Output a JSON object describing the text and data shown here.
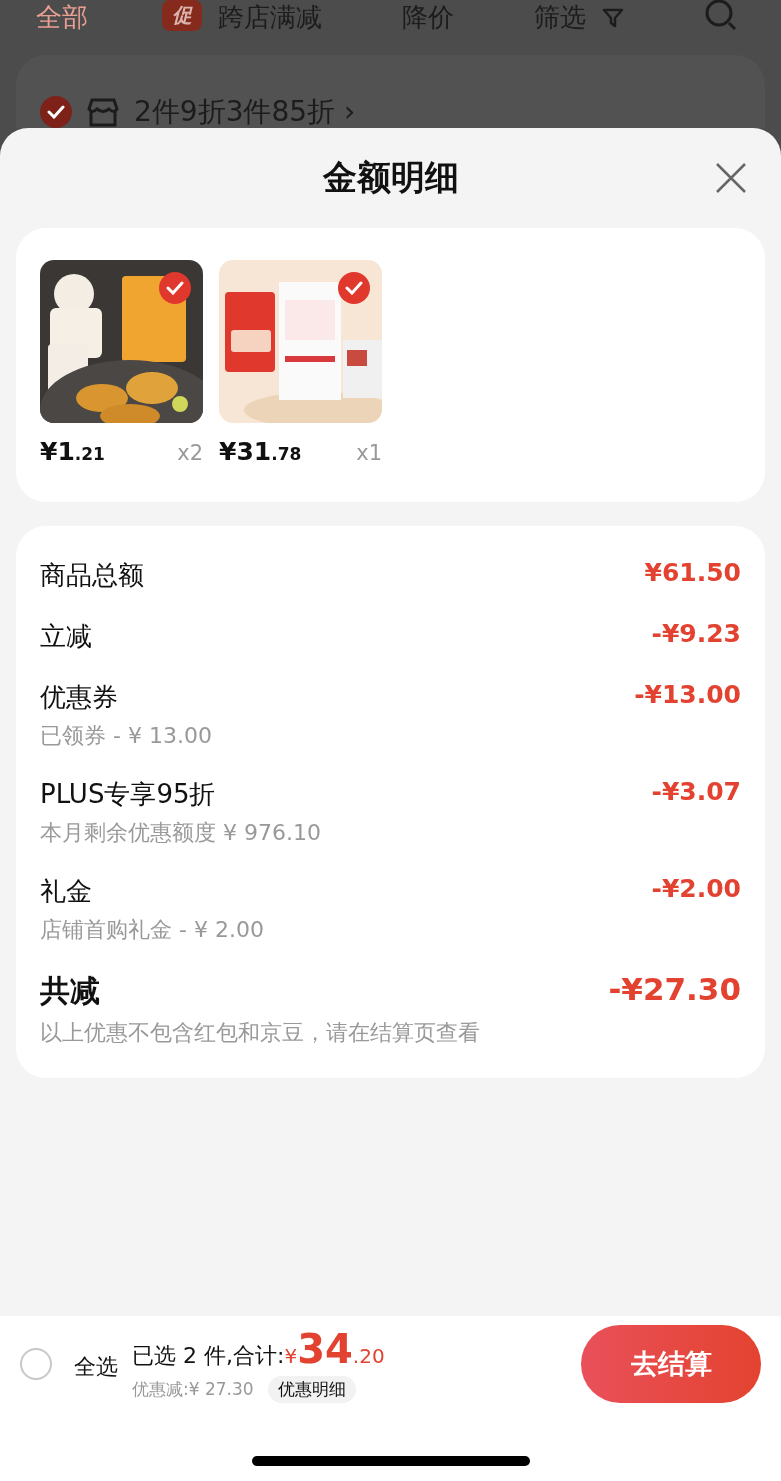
{
  "top_bar": {
    "tabs": [
      {
        "label": "全部",
        "selected": true
      },
      {
        "label": "跨店满减",
        "selected": false,
        "badge": "促"
      },
      {
        "label": "降价",
        "selected": false
      },
      {
        "label": "筛选",
        "selected": false
      }
    ]
  },
  "store_row": {
    "checked": true,
    "text": "2件9折3件85折 ›"
  },
  "sheet": {
    "title": "金额明细",
    "products": [
      {
        "kind": "food",
        "price": "¥1",
        "decimals": ".21",
        "quantity": "x2",
        "checked": true
      },
      {
        "kind": "milk",
        "price": "¥31",
        "decimals": ".78",
        "quantity": "x1",
        "checked": true
      }
    ],
    "breakdown": [
      {
        "kind": "line",
        "label": "商品总额",
        "amount": "¥61.50"
      },
      {
        "kind": "line",
        "label": "立减",
        "amount": "-¥9.23"
      },
      {
        "kind": "line",
        "label": "优惠券",
        "amount": "-¥13.00",
        "note": "已领券 - ¥ 13.00"
      },
      {
        "kind": "line",
        "label": "PLUS专享95折",
        "amount": "-¥3.07",
        "note": "本月剩余优惠额度 ¥ 976.10"
      },
      {
        "kind": "line",
        "label": "礼金",
        "amount": "-¥2.00",
        "note": "店铺首购礼金 - ¥ 2.00"
      },
      {
        "kind": "total",
        "label": "共减",
        "amount": "-¥27.30",
        "note": "以上优惠不包含红包和京豆，请在结算页查看"
      }
    ]
  },
  "bottom_bar": {
    "select_all": {
      "label": "全选",
      "checked": false
    },
    "summary": "已选 2 件,合计:",
    "currency": "¥",
    "total": "34",
    "total_decimals": ".20",
    "discount": "优惠减:¥ 27.30",
    "details_button": "优惠明细",
    "checkout_button": "去结算"
  }
}
